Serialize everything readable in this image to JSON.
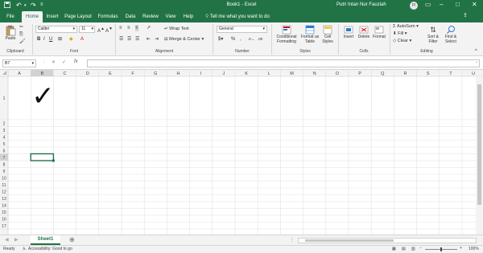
{
  "window": {
    "title": "Book1 - Excel",
    "user_name": "Putri Intan Nur Fauziah",
    "user_initials": "PI"
  },
  "tabs": [
    "File",
    "Home",
    "Insert",
    "Page Layout",
    "Formulas",
    "Data",
    "Review",
    "View",
    "Help"
  ],
  "tell_me": "Tell me what you want to do",
  "ribbon": {
    "clipboard": {
      "paste": "Paste",
      "group": "Clipboard"
    },
    "font": {
      "name": "Calibri",
      "size": "11",
      "group": "Font"
    },
    "alignment": {
      "wrap": "Wrap Text",
      "merge": "Merge & Center",
      "group": "Alignment"
    },
    "number": {
      "format": "General",
      "group": "Number"
    },
    "styles": {
      "conditional": [
        "Conditional",
        "Formatting"
      ],
      "table": [
        "Format as",
        "Table"
      ],
      "cell": [
        "Cell",
        "Styles"
      ],
      "group": "Styles"
    },
    "cells": {
      "insert": "Insert",
      "delete": "Delete",
      "format": "Format",
      "group": "Cells"
    },
    "editing": {
      "autosum": "AutoSum",
      "fill": "Fill",
      "clear": "Clear",
      "sort": [
        "Sort &",
        "Filter"
      ],
      "find": [
        "Find &",
        "Select"
      ],
      "group": "Editing"
    }
  },
  "formula_bar": {
    "name_box": "B7",
    "fx": "fx",
    "value": ""
  },
  "columns": [
    "A",
    "B",
    "C",
    "D",
    "E",
    "F",
    "G",
    "H",
    "I",
    "J",
    "K",
    "L",
    "M",
    "N",
    "O",
    "P",
    "Q",
    "R",
    "S",
    "T",
    "U"
  ],
  "rows": [
    "1",
    "2",
    "3",
    "4",
    "5",
    "6",
    "7",
    "8",
    "9",
    "10",
    "11",
    "12",
    "13",
    "14",
    "15",
    "16",
    "17"
  ],
  "active_cell": {
    "column": "B",
    "row": "7"
  },
  "cells": {
    "B1": "✓"
  },
  "sheets": [
    "Sheet1"
  ],
  "status": {
    "ready": "Ready",
    "accessibility": "Accessibility: Good to go",
    "zoom": "100%"
  },
  "colors": {
    "brand": "#217346",
    "grid": "#e1e1e1"
  }
}
